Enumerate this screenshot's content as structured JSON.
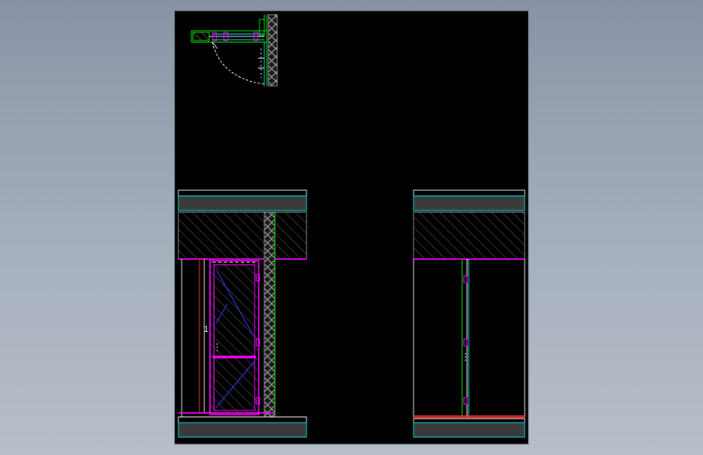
{
  "drawing": {
    "colors": {
      "background": "#8d98aa",
      "viewport": "#000000",
      "cyan": "#00d8d8",
      "green": "#00e000",
      "magenta": "#ff00ff",
      "red": "#ff3030",
      "white": "#e8e8e8",
      "gray": "#7f7f7f",
      "slab": "#3a3a3a"
    },
    "views": [
      {
        "name": "plan-detail"
      },
      {
        "name": "door-elevation"
      },
      {
        "name": "section-view"
      }
    ],
    "annotations": {
      "elevation_mark": "1"
    }
  }
}
